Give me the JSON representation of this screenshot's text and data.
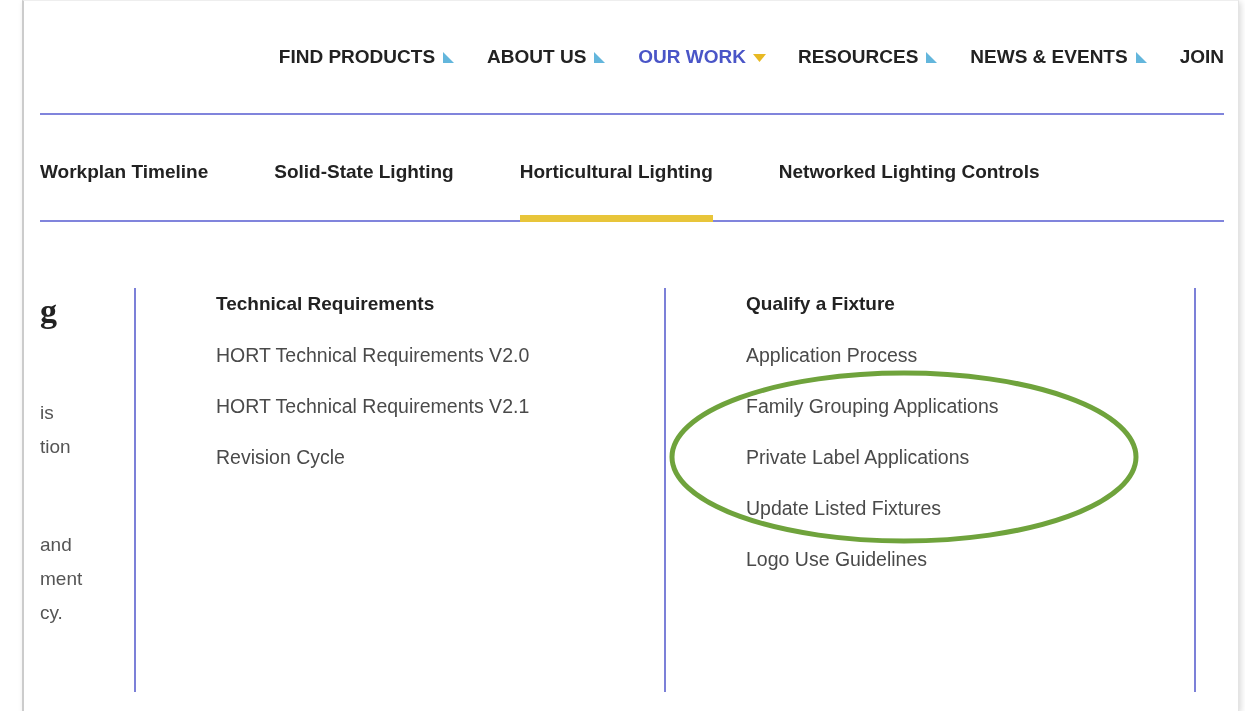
{
  "nav": [
    {
      "label": "FIND PRODUCTS",
      "selected": false,
      "has_menu": true
    },
    {
      "label": "ABOUT US",
      "selected": false,
      "has_menu": true
    },
    {
      "label": "OUR WORK",
      "selected": true,
      "has_menu": true
    },
    {
      "label": "RESOURCES",
      "selected": false,
      "has_menu": true
    },
    {
      "label": "NEWS & EVENTS",
      "selected": false,
      "has_menu": true
    },
    {
      "label": "JOIN",
      "selected": false,
      "has_menu": false
    }
  ],
  "subnav": [
    {
      "label": "Workplan Timeline",
      "selected": false
    },
    {
      "label": "Solid-State Lighting",
      "selected": false
    },
    {
      "label": "Horticultural Lighting",
      "selected": true
    },
    {
      "label": "Networked Lighting Controls",
      "selected": false
    }
  ],
  "intro": {
    "heading": "g",
    "lines_top": [
      "is",
      "tion"
    ],
    "lines_bottom": [
      "and",
      "ment",
      "cy."
    ]
  },
  "columns": [
    {
      "heading": "Technical Requirements",
      "links": [
        "HORT Technical Requirements V2.0",
        "HORT Technical Requirements V2.1",
        "Revision Cycle"
      ]
    },
    {
      "heading": "Qualify a Fixture",
      "links": [
        "Application Process",
        "Family Grouping Applications",
        "Private Label Applications",
        "Update Listed Fixtures",
        "Logo Use Guidelines"
      ]
    }
  ],
  "annotation": {
    "kind": "ellipse",
    "color": "#6fa33c"
  }
}
